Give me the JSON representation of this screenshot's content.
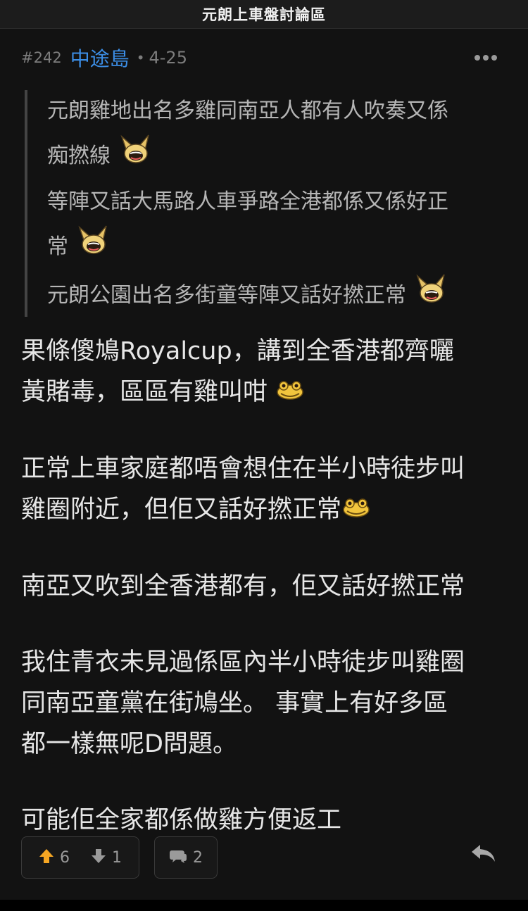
{
  "header": {
    "title": "元朗上車盤討論區"
  },
  "post": {
    "number": "#242",
    "author": "中途島",
    "separator": "•",
    "date": "4-25"
  },
  "quote": {
    "lines": [
      "元朗雞地出名多雞同南亞人都有人吹奏又係",
      "痴撚線",
      "等陣又話大馬路人車爭路全港都係又係好正",
      "常",
      "元朗公園出名多街童等陣又話好撚正常"
    ],
    "emoji": "laugh-emoji"
  },
  "body": {
    "lines": [
      "果條傻鳩Royalcup，講到全香港都齊曬",
      "黃賭毒，區區有雞叫咁",
      "正常上車家庭都唔會想住在半小時徒步叫",
      "雞圈附近，但佢又話好撚正常",
      "南亞又吹到全香港都有，佢又話好撚正常",
      "我住青衣未見過係區內半小時徒步叫雞圈",
      "同南亞童黨在街鳩坐。 事實上有好多區",
      "都一樣無呢D問題。",
      "可能佢全家都係做雞方便返工"
    ]
  },
  "actions": {
    "upvotes": "6",
    "downvotes": "1",
    "comments": "2",
    "upvote_color": "#f5a623"
  }
}
